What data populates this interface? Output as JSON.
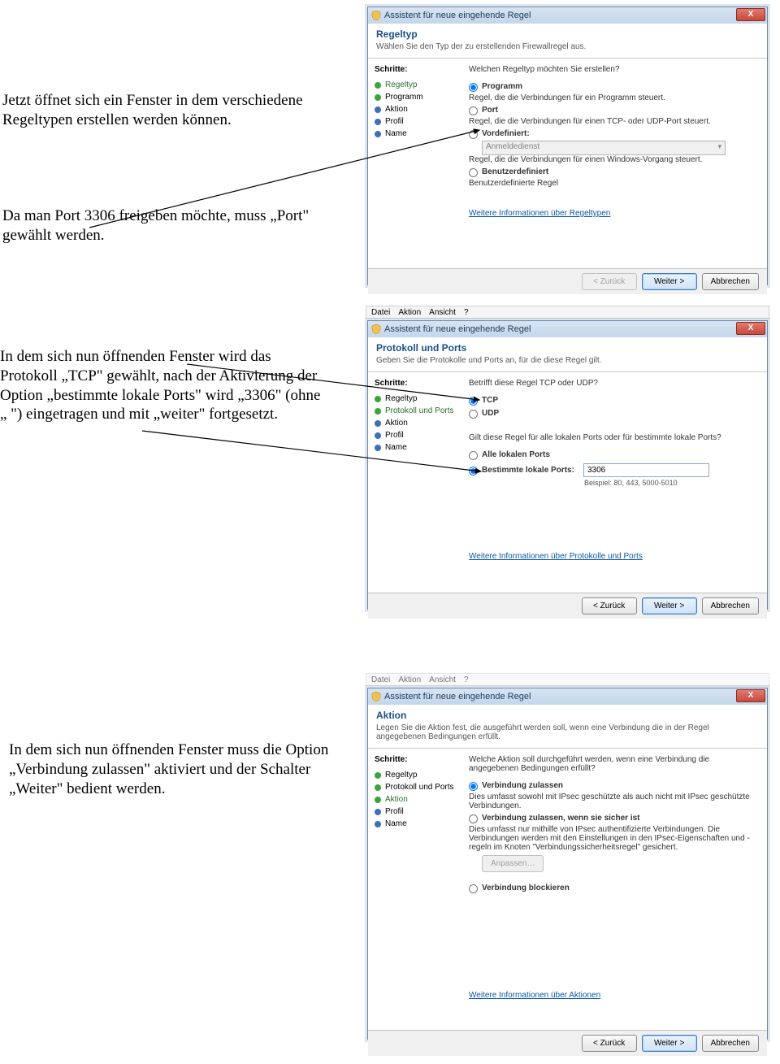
{
  "doc": {
    "p1a": "Jetzt öffnet sich ein Fenster in dem verschiedene Regeltypen erstellen werden können.",
    "p1b": "Da man Port 3306 freigeben möchte, muss „Port\" gewählt werden.",
    "p2": "In dem sich nun öffnenden Fenster wird das Protokoll „TCP\" gewählt, nach der Aktivierung der Option „bestimmte lokale Ports\" wird „3306\" (ohne „ \") eingetragen und mit „weiter\" fortgesetzt.",
    "p3": "In dem sich nun öffnenden Fenster muss die Option „Verbindung zulassen\" aktiviert und der Schalter „Weiter\" bedient werden."
  },
  "common": {
    "window_title": "Assistent für neue eingehende Regel",
    "steps_label": "Schritte:",
    "back": "< Zurück",
    "next": "Weiter >",
    "cancel": "Abbrechen",
    "close": "X"
  },
  "menubar": {
    "file": "Datei",
    "action": "Aktion",
    "view": "Ansicht",
    "help": "?"
  },
  "win1": {
    "h1": "Regeltyp",
    "h2": "Wählen Sie den Typ der zu erstellenden Firewallregel aus.",
    "steps": [
      {
        "label": "Regeltyp",
        "state": "current"
      },
      {
        "label": "Programm",
        "state": "done"
      },
      {
        "label": "Aktion",
        "state": "pending"
      },
      {
        "label": "Profil",
        "state": "pending"
      },
      {
        "label": "Name",
        "state": "pending"
      }
    ],
    "q": "Welchen Regeltyp möchten Sie erstellen?",
    "opt_prog": "Programm",
    "opt_prog_desc": "Regel, die die Verbindungen für ein Programm steuert.",
    "opt_port": "Port",
    "opt_port_desc": "Regel, die die Verbindungen für einen TCP- oder UDP-Port steuert.",
    "opt_pre": "Vordefiniert:",
    "opt_pre_combo": "Anmeldedienst",
    "opt_pre_desc": "Regel, die die Verbindungen für einen Windows-Vorgang steuert.",
    "opt_cust": "Benutzerdefiniert",
    "opt_cust_desc": "Benutzerdefinierte Regel",
    "more": "Weitere Informationen über Regeltypen"
  },
  "win2": {
    "h1": "Protokoll und Ports",
    "h2": "Geben Sie die Protokolle und Ports an, für die diese Regel gilt.",
    "steps": [
      {
        "label": "Regeltyp",
        "state": "done"
      },
      {
        "label": "Protokoll und Ports",
        "state": "current"
      },
      {
        "label": "Aktion",
        "state": "pending"
      },
      {
        "label": "Profil",
        "state": "pending"
      },
      {
        "label": "Name",
        "state": "pending"
      }
    ],
    "q1": "Betrifft diese Regel TCP oder UDP?",
    "tcp": "TCP",
    "udp": "UDP",
    "q2": "Gilt diese Regel für alle lokalen Ports oder für bestimmte lokale Ports?",
    "all": "Alle lokalen Ports",
    "spec": "Bestimmte lokale Ports:",
    "port_value": "3306",
    "example": "Beispiel: 80, 443, 5000-5010",
    "more": "Weitere Informationen über Protokolle und Ports"
  },
  "win3": {
    "h1": "Aktion",
    "h2": "Legen Sie die Aktion fest, die ausgeführt werden soll, wenn eine Verbindung die in der Regel angegebenen Bedingungen erfüllt.",
    "steps": [
      {
        "label": "Regeltyp",
        "state": "done"
      },
      {
        "label": "Protokoll und Ports",
        "state": "done"
      },
      {
        "label": "Aktion",
        "state": "current"
      },
      {
        "label": "Profil",
        "state": "pending"
      },
      {
        "label": "Name",
        "state": "pending"
      }
    ],
    "q": "Welche Aktion soll durchgeführt werden, wenn eine Verbindung die angegebenen Bedingungen erfüllt?",
    "allow": "Verbindung zulassen",
    "allow_desc": "Dies umfasst sowohl mit IPsec geschützte als auch nicht mit IPsec geschützte Verbindungen.",
    "allow_sec": "Verbindung zulassen, wenn sie sicher ist",
    "allow_sec_desc": "Dies umfasst nur mithilfe von IPsec authentifizierte Verbindungen. Die Verbindungen werden mit den Einstellungen in den IPsec-Eigenschaften und -regeln im Knoten \"Verbindungssicherheitsregel\" gesichert.",
    "customize": "Anpassen…",
    "block": "Verbindung blockieren",
    "more": "Weitere Informationen über Aktionen"
  }
}
